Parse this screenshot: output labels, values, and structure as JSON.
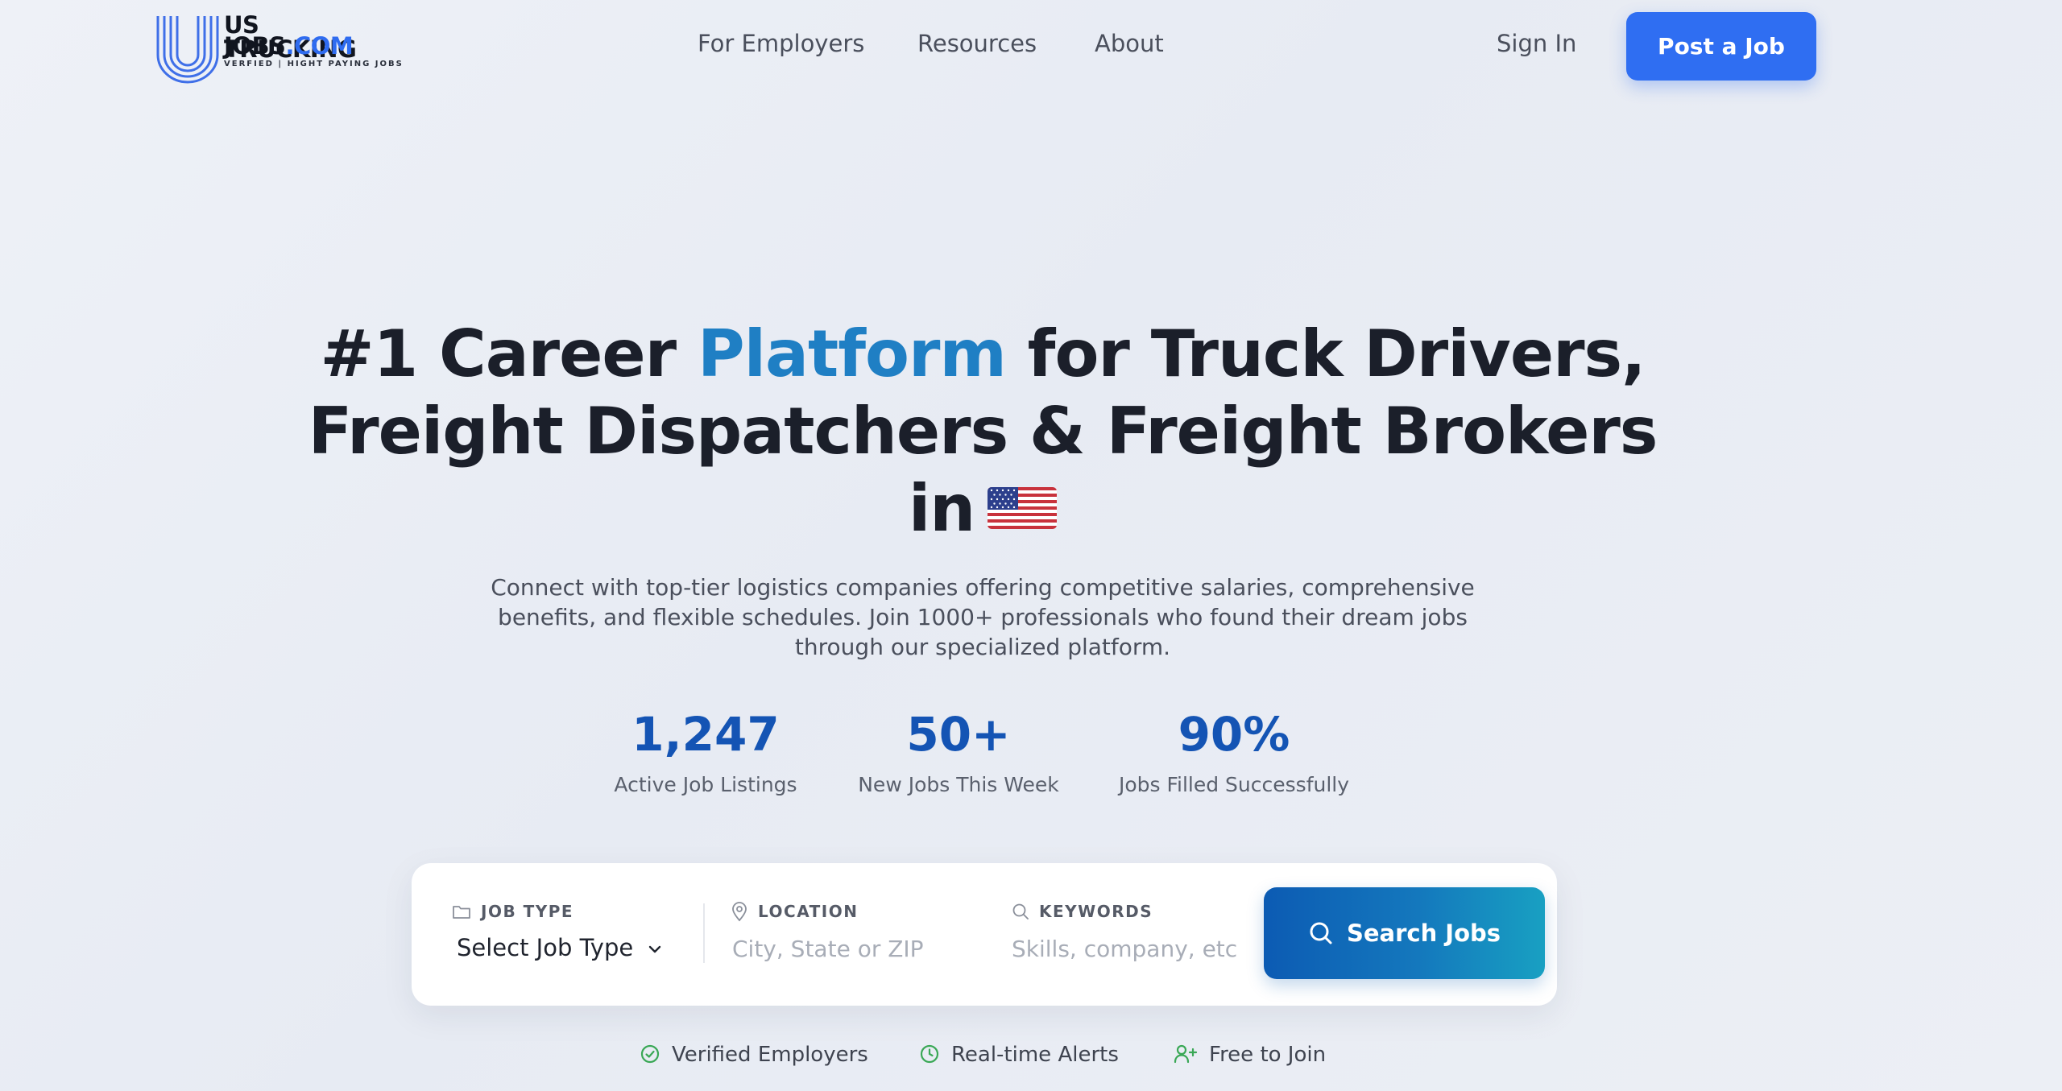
{
  "brand": {
    "line1": "US TRUCKING",
    "line2_main": "JOBS",
    "line2_accent": ".COM",
    "tagline": "VERFIED | HIGHT PAYING JOBS"
  },
  "nav": {
    "items": [
      {
        "label": "For Employers"
      },
      {
        "label": "Resources"
      },
      {
        "label": "About"
      }
    ],
    "sign_in": "Sign In",
    "post_job": "Post a Job"
  },
  "hero": {
    "title_part1": "#1 Career ",
    "title_highlight": "Platform",
    "title_part2": " for Truck Drivers,",
    "title_line2": "Freight Dispatchers & Freight Brokers",
    "title_line3": "in",
    "subtitle": "Connect with top-tier logistics companies offering competitive salaries, comprehensive benefits, and flexible schedules. Join 1000+ professionals who found their dream jobs through our specialized platform."
  },
  "stats": [
    {
      "value": "1,247",
      "label": "Active Job Listings"
    },
    {
      "value": "50+",
      "label": "New Jobs This Week"
    },
    {
      "value": "90%",
      "label": "Jobs Filled Successfully"
    }
  ],
  "search": {
    "job_type_label": "JOB TYPE",
    "job_type_value": "Select Job Type",
    "location_label": "LOCATION",
    "location_placeholder": "City, State or ZIP",
    "keywords_label": "KEYWORDS",
    "keywords_placeholder": "Skills, company, etc",
    "button": "Search Jobs"
  },
  "features": [
    {
      "label": "Verified Employers",
      "icon": "check-circle-icon"
    },
    {
      "label": "Real-time Alerts",
      "icon": "clock-icon"
    },
    {
      "label": "Free to Join",
      "icon": "user-plus-icon"
    }
  ],
  "colors": {
    "accent": "#2f6ef2",
    "headline_highlight": "#1f7fc4",
    "stat_value": "#1454b4",
    "feature_icon": "#3aa856"
  }
}
